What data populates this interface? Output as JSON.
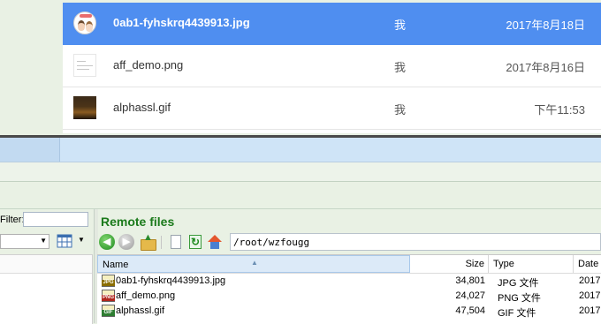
{
  "drive": {
    "files": [
      {
        "name": "0ab1-fyhskrq4439913.jpg",
        "owner": "我",
        "modified": "2017年8月18日",
        "thumb": "avatar-thumb",
        "selected": true
      },
      {
        "name": "aff_demo.png",
        "owner": "我",
        "modified": "2017年8月16日",
        "thumb": "document-thumb",
        "selected": false
      },
      {
        "name": "alphassl.gif",
        "owner": "我",
        "modified": "下午11:53",
        "thumb": "dark-image-thumb",
        "selected": false
      }
    ]
  },
  "local": {
    "filter_label": "Filter:",
    "filter_value": ""
  },
  "remote": {
    "title": "Remote files",
    "path": "/root/wzfougg",
    "toolbar_icons": [
      "back-icon",
      "forward-icon",
      "parent-folder-icon",
      "new-file-icon",
      "refresh-icon",
      "home-icon"
    ],
    "columns": {
      "name": "Name",
      "size": "Size",
      "type": "Type",
      "date": "Date"
    },
    "files": [
      {
        "name": "0ab1-fyhskrq4439913.jpg",
        "size": "34,801",
        "type": "JPG 文件",
        "date": "2017",
        "icon": "JPG",
        "icon_color": "#8a6d00"
      },
      {
        "name": "aff_demo.png",
        "size": "24,027",
        "type": "PNG 文件",
        "date": "2017",
        "icon": "PNG",
        "icon_color": "#b0281e"
      },
      {
        "name": "alphassl.gif",
        "size": "47,504",
        "type": "GIF 文件",
        "date": "2017",
        "icon": "GIF",
        "icon_color": "#2e7d32"
      }
    ]
  }
}
